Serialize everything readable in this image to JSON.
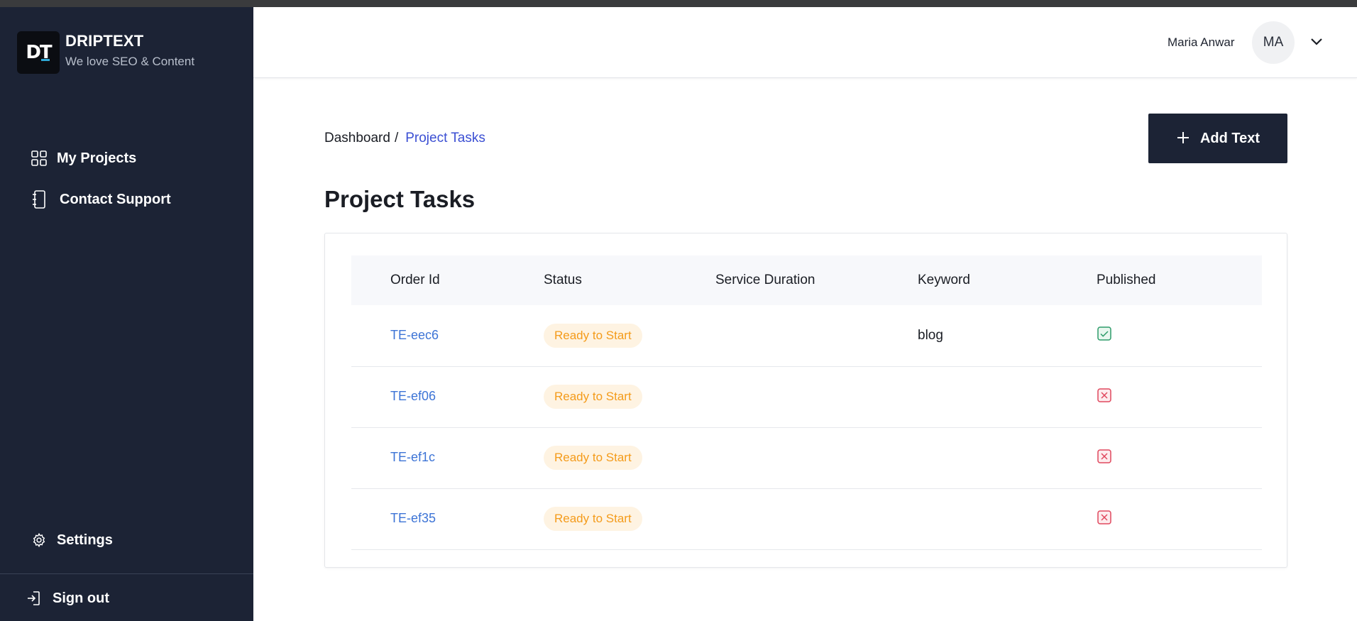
{
  "brand": {
    "logo_text": "DT",
    "name": "DRIPTEXT",
    "tagline": "We love SEO & Content"
  },
  "sidebar": {
    "items": [
      {
        "label": "My Projects",
        "icon": "grid-icon"
      },
      {
        "label": "Contact Support",
        "icon": "notebook-icon"
      }
    ],
    "settings_label": "Settings",
    "signout_label": "Sign out"
  },
  "header": {
    "user_name": "Maria Anwar",
    "avatar_initials": "MA"
  },
  "breadcrumb": {
    "root": "Dashboard",
    "separator": "/",
    "current": "Project Tasks"
  },
  "toolbar": {
    "add_label": "Add Text"
  },
  "main": {
    "title": "Project Tasks"
  },
  "table": {
    "columns": [
      "Order Id",
      "Status",
      "Service Duration",
      "Keyword",
      "Published"
    ],
    "rows": [
      {
        "order_id": "TE-eec6",
        "status": "Ready to Start",
        "duration": "",
        "keyword": "blog",
        "published": true
      },
      {
        "order_id": "TE-ef06",
        "status": "Ready to Start",
        "duration": "",
        "keyword": "",
        "published": false
      },
      {
        "order_id": "TE-ef1c",
        "status": "Ready to Start",
        "duration": "",
        "keyword": "",
        "published": false
      },
      {
        "order_id": "TE-ef35",
        "status": "Ready to Start",
        "duration": "",
        "keyword": "",
        "published": false
      }
    ]
  },
  "colors": {
    "sidebar_bg": "#1c2335",
    "accent": "#3b4fd3",
    "link": "#3d74d6",
    "badge_text": "#f49b1a",
    "badge_bg": "#fef3e2",
    "published_yes": "#2e9c6a",
    "published_no": "#e0485e"
  }
}
